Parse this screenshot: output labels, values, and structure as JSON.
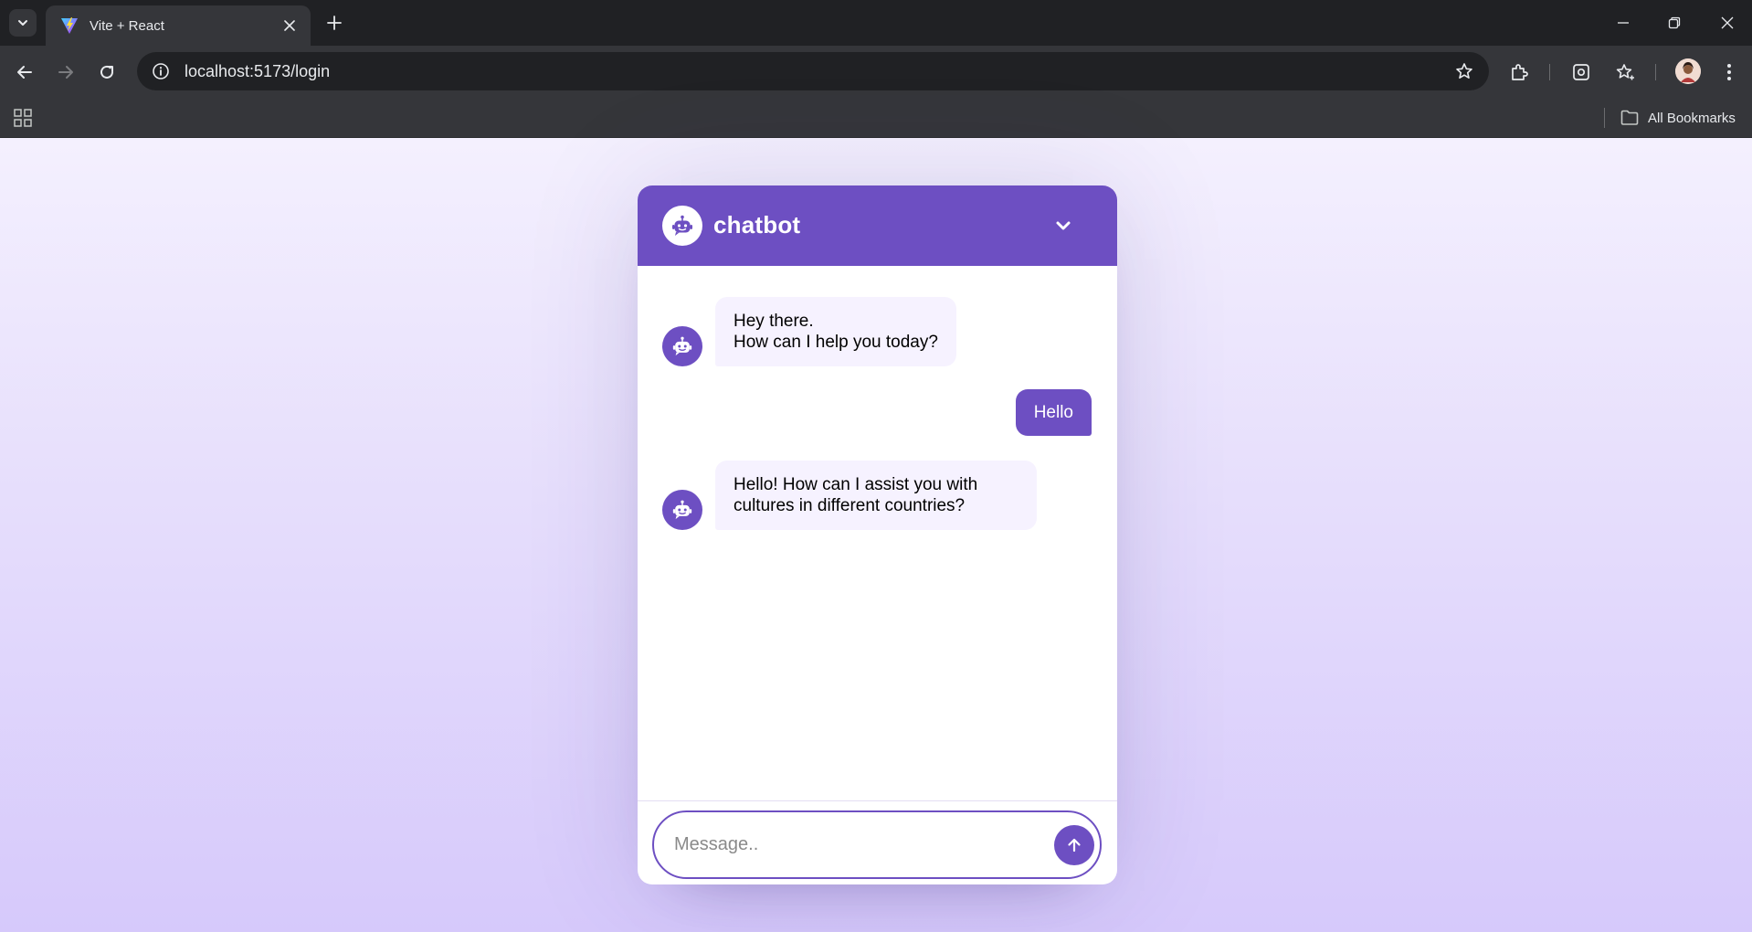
{
  "browser": {
    "tab_title": "Vite + React",
    "url": "localhost:5173/login",
    "bookmarks_label": "All Bookmarks"
  },
  "chatbot": {
    "title": "chatbot",
    "messages": [
      {
        "role": "bot",
        "text": "Hey there.\nHow can I help you today?"
      },
      {
        "role": "user",
        "text": "Hello"
      },
      {
        "role": "bot",
        "text": "Hello! How can I assist you with cultures in different countries?"
      }
    ],
    "input_placeholder": "Message..",
    "accent_color": "#6d4fc2",
    "bot_bubble_color": "#f6f2ff"
  },
  "icons": {
    "tab_search": "chevron-down-icon",
    "favicon": "vite-logo-icon",
    "tab_close": "close-icon",
    "new_tab": "plus-icon",
    "header_logo": "robot-icon",
    "header_toggle": "chevron-down-icon",
    "send": "arrow-up-icon"
  }
}
